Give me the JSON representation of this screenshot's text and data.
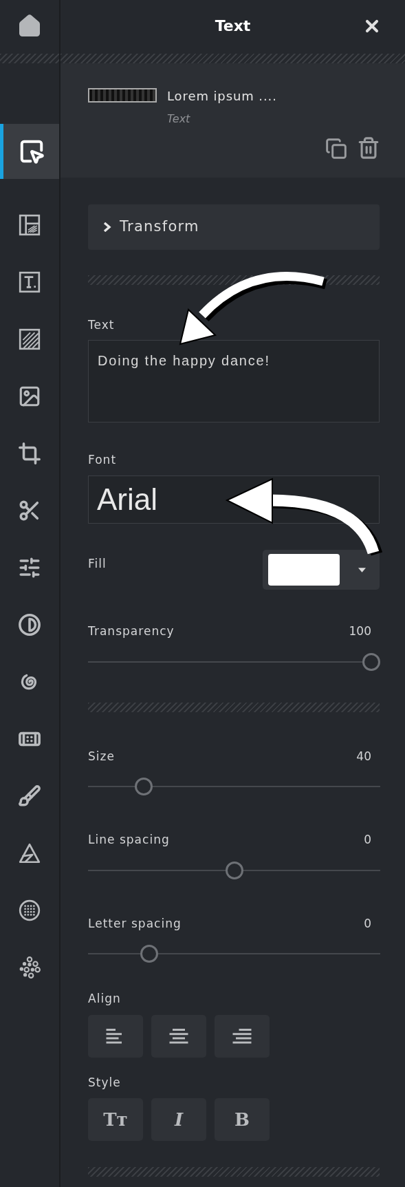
{
  "sidebar": {
    "items": [
      {
        "selected": true
      },
      {
        "selected": false
      },
      {
        "selected": false
      },
      {
        "selected": false
      },
      {
        "selected": false
      },
      {
        "selected": false
      },
      {
        "selected": false
      },
      {
        "selected": false
      },
      {
        "selected": false
      },
      {
        "selected": false
      },
      {
        "selected": false
      },
      {
        "selected": false
      },
      {
        "selected": false
      },
      {
        "selected": false
      },
      {
        "selected": false
      }
    ]
  },
  "panel": {
    "title": "Text",
    "layer": {
      "name": "Lorem ipsum ....",
      "type": "Text"
    },
    "transform": {
      "label": "Transform",
      "expanded": false
    },
    "text_field": {
      "label": "Text",
      "value": "Doing the happy dance!"
    },
    "font_field": {
      "label": "Font",
      "value": "Arial"
    },
    "fill": {
      "label": "Fill",
      "color": "#ffffff"
    },
    "sliders_top": [
      {
        "label": "Transparency",
        "reading": "100",
        "level": 1.0
      }
    ],
    "sliders": [
      {
        "label": "Size",
        "reading": "40",
        "level": 0.17
      },
      {
        "label": "Line spacing",
        "reading": "0",
        "level": 0.5
      },
      {
        "label": "Letter spacing",
        "reading": "0",
        "level": 0.19
      }
    ],
    "align": {
      "label": "Align",
      "buttons": [
        {
          "kind": "left",
          "selected": false
        },
        {
          "kind": "center",
          "selected": false
        },
        {
          "kind": "right",
          "selected": false
        }
      ]
    },
    "style": {
      "label": "Style",
      "buttons": [
        {
          "kind": "case",
          "label": "Tт",
          "selected": false
        },
        {
          "kind": "italic",
          "label": "I",
          "selected": false
        },
        {
          "kind": "bold",
          "label": "B",
          "selected": false
        }
      ]
    }
  }
}
